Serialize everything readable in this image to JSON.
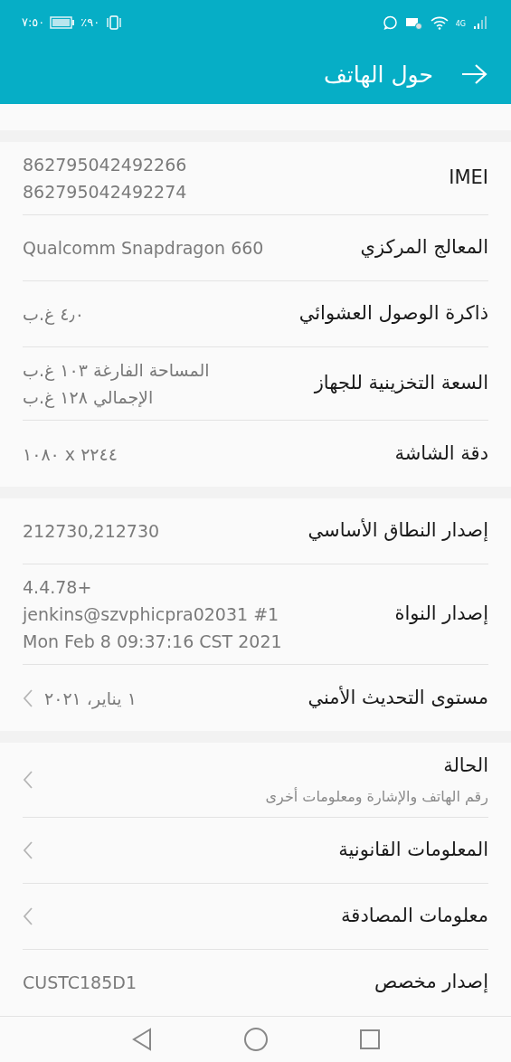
{
  "status_bar": {
    "time": "٧:٥٠",
    "battery": "٪٩٠",
    "network": "4G"
  },
  "header": {
    "title": "حول الهاتف"
  },
  "sections": [
    {
      "rows": [
        {
          "kind": "value",
          "label": "IMEI",
          "value": [
            "862795042492266",
            "862795042492274"
          ]
        },
        {
          "kind": "value",
          "label": "المعالج المركزي",
          "value": [
            "Qualcomm Snapdragon 660"
          ]
        },
        {
          "kind": "value",
          "label": "ذاكرة الوصول العشوائي",
          "value": [
            "٤٫٠ غ.ب"
          ]
        },
        {
          "kind": "value",
          "label": "السعة التخزينية للجهاز",
          "value": [
            "المساحة الفارغة ١٠٣  غ.ب",
            "الإجمالي ١٢٨  غ.ب"
          ]
        },
        {
          "kind": "value",
          "label": "دقة الشاشة",
          "value": [
            "١٠٨٠ x ٢٢٤٤"
          ]
        }
      ]
    },
    {
      "rows": [
        {
          "kind": "value",
          "label": "إصدار النطاق الأساسي",
          "value": [
            "212730,212730"
          ]
        },
        {
          "kind": "value",
          "label": "إصدار النواة",
          "value": [
            "4.4.78+",
            "jenkins@szvphicpra02031 #1",
            "Mon Feb 8 09:37:16 CST 2021"
          ]
        },
        {
          "kind": "link",
          "label": "مستوى التحديث الأمني",
          "value": [
            "١ يناير، ٢٠٢١"
          ]
        }
      ]
    },
    {
      "rows": [
        {
          "kind": "link",
          "label": "الحالة",
          "subtitle": "رقم الهاتف والإشارة ومعلومات أخرى"
        },
        {
          "kind": "link",
          "label": "المعلومات القانونية"
        },
        {
          "kind": "link",
          "label": "معلومات المصادقة"
        },
        {
          "kind": "value",
          "label": "إصدار مخصص",
          "value": [
            "CUSTC185D1"
          ]
        }
      ]
    }
  ]
}
